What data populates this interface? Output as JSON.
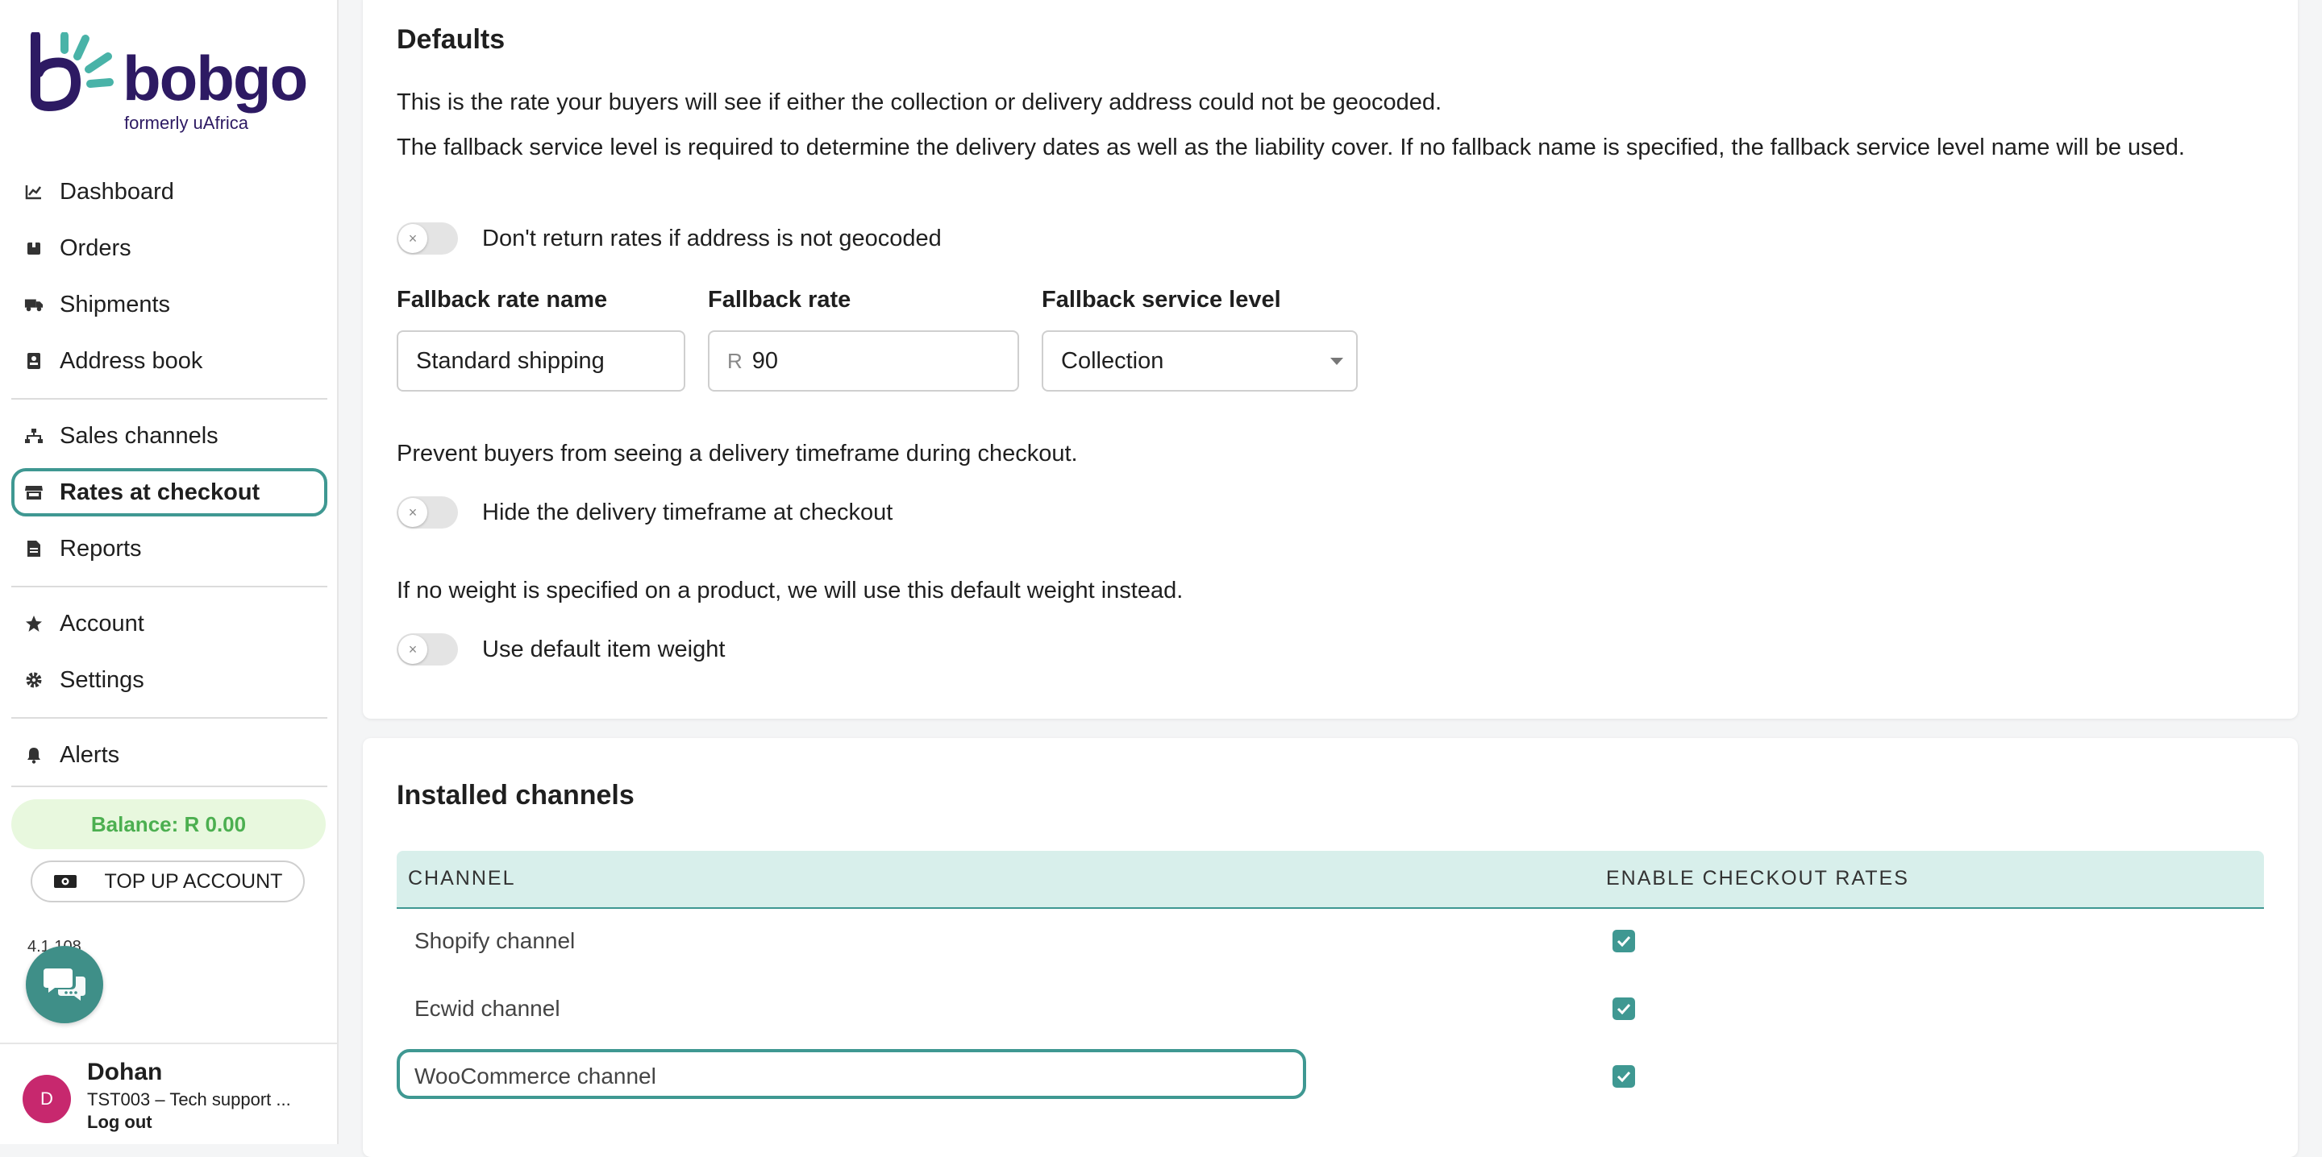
{
  "brand": {
    "name": "bobgo",
    "tagline": "formerly uAfrica",
    "accent_color": "#3f9892",
    "primary_color": "#2d1a63"
  },
  "sidebar": {
    "items": [
      {
        "label": "Dashboard",
        "icon": "chart-line-icon"
      },
      {
        "label": "Orders",
        "icon": "box-icon"
      },
      {
        "label": "Shipments",
        "icon": "truck-icon"
      },
      {
        "label": "Address book",
        "icon": "address-book-icon"
      },
      {
        "label": "Sales channels",
        "icon": "sitemap-icon"
      },
      {
        "label": "Rates at checkout",
        "icon": "store-icon",
        "active": true
      },
      {
        "label": "Reports",
        "icon": "file-icon"
      },
      {
        "label": "Account",
        "icon": "star-icon"
      },
      {
        "label": "Settings",
        "icon": "gear-icon"
      },
      {
        "label": "Alerts",
        "icon": "bell-icon"
      }
    ],
    "balance": "Balance: R 0.00",
    "top_up": "TOP UP ACCOUNT",
    "version": "4.1.108"
  },
  "user": {
    "initial": "D",
    "name": "Dohan",
    "org": "TST003 – Tech support ...",
    "logout": "Log out"
  },
  "defaults": {
    "title": "Defaults",
    "desc1": "This is the rate your buyers will see if either the collection or delivery address could not be geocoded.",
    "desc2": "The fallback service level is required to determine the delivery dates as well as the liability cover. If no fallback name is specified, the fallback service level name will be used.",
    "toggle_geocode": "Don't return rates if address is not geocoded",
    "fallback_rate_name_label": "Fallback rate name",
    "fallback_rate_name_value": "Standard shipping",
    "fallback_rate_label": "Fallback rate",
    "fallback_rate_prefix": "R",
    "fallback_rate_value": "90",
    "fallback_service_label": "Fallback service level",
    "fallback_service_value": "Collection",
    "timeframe_desc": "Prevent buyers from seeing a delivery timeframe during checkout.",
    "toggle_timeframe": "Hide the delivery timeframe at checkout",
    "weight_desc": "If no weight is specified on a product, we will use this default weight instead.",
    "toggle_weight": "Use default item weight"
  },
  "channels": {
    "title": "Installed channels",
    "col_channel": "CHANNEL",
    "col_enable": "ENABLE CHECKOUT RATES",
    "rows": [
      {
        "name": "Shopify channel",
        "enabled": true
      },
      {
        "name": "Ecwid channel",
        "enabled": true
      },
      {
        "name": "WooCommerce channel",
        "enabled": true
      }
    ]
  }
}
